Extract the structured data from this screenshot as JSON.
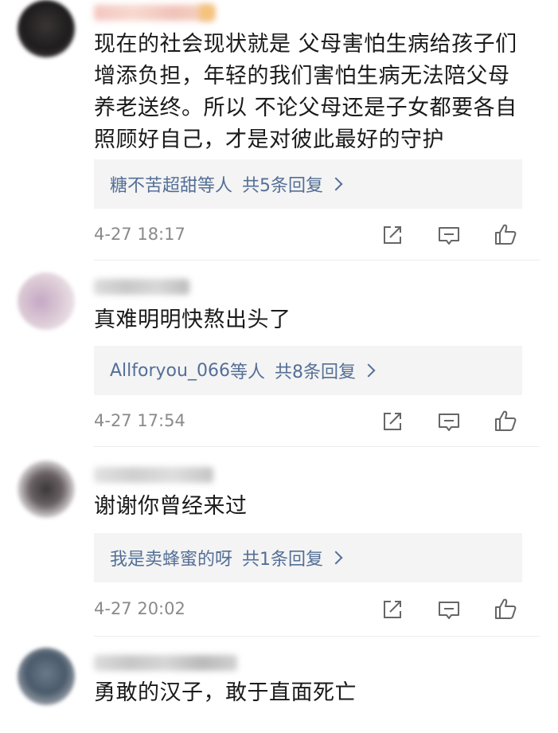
{
  "comments": [
    {
      "text": "现在的社会现状就是 父母害怕生病给孩子们增添负担，年轻的我们害怕生病无法陪父母养老送终。所以  不论父母还是子女都要各自照顾好自己，才是对彼此最好的守护",
      "reply": {
        "names": "糖不苦超甜",
        "suffix": "等人",
        "count": "共5条回复"
      },
      "time": "4-27 18:17"
    },
    {
      "text": "真难明明快熬出头了",
      "reply": {
        "names": "Allforyou_066",
        "suffix": "等人",
        "count": "共8条回复"
      },
      "time": "4-27 17:54"
    },
    {
      "text": "谢谢你曾经来过",
      "reply": {
        "names": "我是卖蜂蜜的呀",
        "suffix": "",
        "count": "共1条回复"
      },
      "time": "4-27 20:02"
    },
    {
      "text": "勇敢的汉子，敢于直面死亡"
    }
  ],
  "icons": {
    "share": "share-icon",
    "comment": "comment-icon",
    "like": "thumbs-up-icon"
  },
  "colors": {
    "link": "#546f96",
    "meta": "#8a8a8a",
    "reply_bg": "#f4f4f4"
  }
}
